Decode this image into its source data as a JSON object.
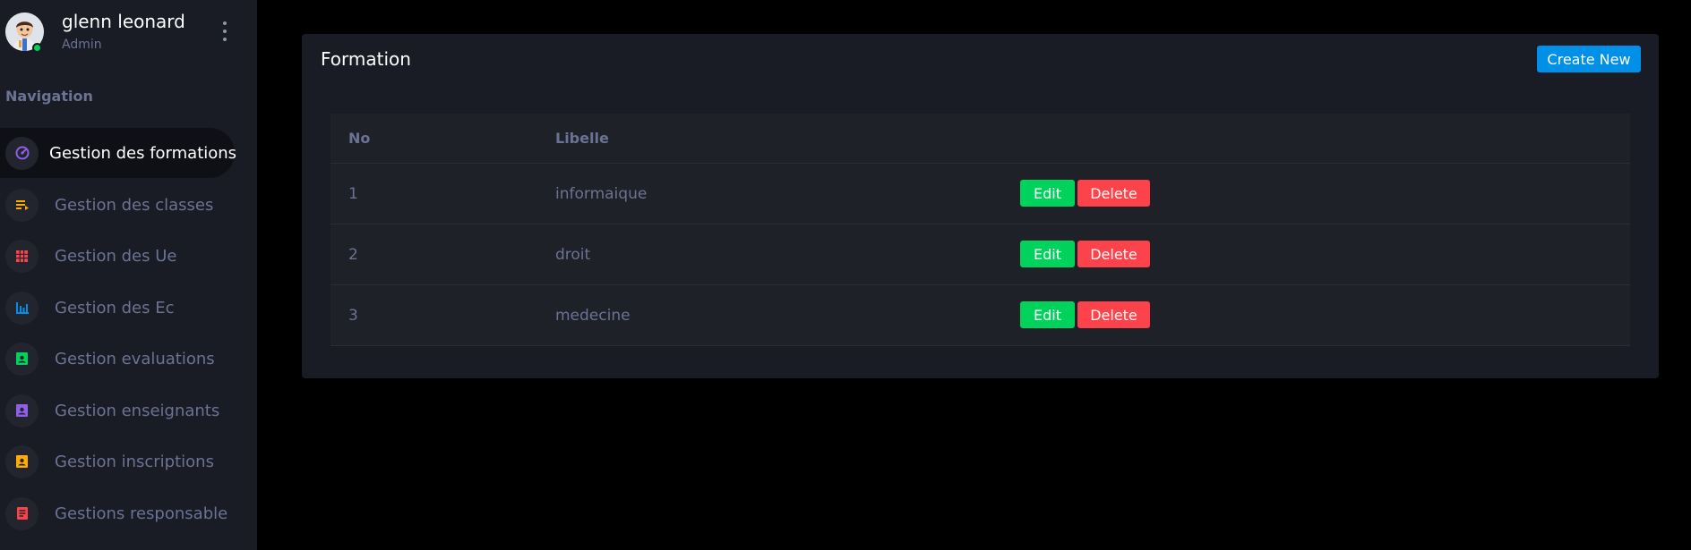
{
  "profile": {
    "name": "glenn leonard",
    "role": "Admin",
    "avatar_icon": "user-avatar-icon",
    "status_color": "#00d25b"
  },
  "sidebar": {
    "heading": "Navigation",
    "items": [
      {
        "label": "Gestion des formations",
        "icon": "speedometer-icon",
        "color": "#8f5fe8",
        "active": true
      },
      {
        "label": "Gestion des classes",
        "icon": "playlist-icon",
        "color": "#ffab00",
        "active": false
      },
      {
        "label": "Gestion des Ue",
        "icon": "table-icon",
        "color": "#fc424a",
        "active": false
      },
      {
        "label": "Gestion des Ec",
        "icon": "bar-chart-icon",
        "color": "#0090e7",
        "active": false
      },
      {
        "label": "Gestion evaluations",
        "icon": "contacts-icon",
        "color": "#00d25b",
        "active": false
      },
      {
        "label": "Gestion enseignants",
        "icon": "contacts-icon",
        "color": "#8f5fe8",
        "active": false
      },
      {
        "label": "Gestion inscriptions",
        "icon": "contacts-icon",
        "color": "#ffab00",
        "active": false
      },
      {
        "label": "Gestions responsable",
        "icon": "document-icon",
        "color": "#fc424a",
        "active": false
      }
    ]
  },
  "card": {
    "title": "Formation",
    "create_label": "Create New"
  },
  "table": {
    "headers": [
      "No",
      "Libelle"
    ],
    "rows": [
      {
        "no": "1",
        "libelle": "informaique"
      },
      {
        "no": "2",
        "libelle": "droit"
      },
      {
        "no": "3",
        "libelle": "medecine"
      }
    ],
    "edit_label": "Edit",
    "delete_label": "Delete"
  }
}
